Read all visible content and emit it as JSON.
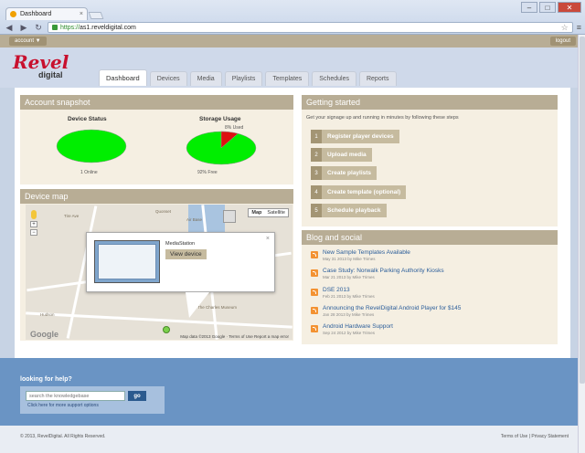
{
  "browser": {
    "tab_title": "Dashboard",
    "tab_close": "×",
    "url_scheme": "https://",
    "url_rest": "as1.reveldigital.com"
  },
  "account_bar": {
    "account_label": "account ▼",
    "logout_label": "logout"
  },
  "logo": {
    "main": "Revel",
    "sub": "digital"
  },
  "nav": {
    "tabs": [
      {
        "label": "Dashboard",
        "active": true
      },
      {
        "label": "Devices"
      },
      {
        "label": "Media"
      },
      {
        "label": "Playlists"
      },
      {
        "label": "Templates"
      },
      {
        "label": "Schedules"
      },
      {
        "label": "Reports"
      }
    ]
  },
  "snapshot": {
    "title": "Account snapshot",
    "device_status": {
      "title": "Device Status",
      "caption": "1 Online",
      "online_fraction": 1.0
    },
    "storage_usage": {
      "title": "Storage Usage",
      "used_label": "8% Used",
      "free_label": "92% Free",
      "used_fraction": 0.08
    }
  },
  "device_map": {
    "title": "Device map",
    "map_button": "Map",
    "satellite_button": "Satellite",
    "device_name": "MediaStation",
    "view_button": "View device",
    "close": "×",
    "attribution": "Map data ©2013 Google · Terms of Use  Report a map error",
    "google_logo": "Google",
    "labels": [
      "Tire Ave",
      "Quonset",
      "Air Base",
      "Hudson",
      "The Charles Museum",
      "Market St"
    ]
  },
  "getting_started": {
    "title": "Getting started",
    "intro": "Get your signage up and running in minutes by following these steps",
    "steps": [
      {
        "num": "1",
        "label": "Register player devices"
      },
      {
        "num": "2",
        "label": "Upload media"
      },
      {
        "num": "3",
        "label": "Create playlists"
      },
      {
        "num": "4",
        "label": "Create template (optional)"
      },
      {
        "num": "5",
        "label": "Schedule playback"
      }
    ]
  },
  "blog": {
    "title": "Blog and social",
    "items": [
      {
        "title": "New Sample Templates Available",
        "meta": "May 31 2013 by Mike Trimes"
      },
      {
        "title": "Case Study: Norwalk Parking Authority Kiosks",
        "meta": "Mar 21 2013 by Mike Trimes"
      },
      {
        "title": "DSE 2013",
        "meta": "Feb 21 2013 by Mike Trimes"
      },
      {
        "title": "Announcing the RevelDigital Android Player for $145",
        "meta": "Jan 28 2013 by Mike Trimes"
      },
      {
        "title": "Android Hardware Support",
        "meta": "Sep 24 2012 by Mike Trimes"
      }
    ]
  },
  "help": {
    "title": "looking for help?",
    "placeholder": "search the knowledgebase",
    "go": "go",
    "more": "Click here for more support options"
  },
  "footer": {
    "copyright": "© 2013, RevelDigital. All Rights Reserved.",
    "links": "Terms of Use | Privacy Statement"
  },
  "colors": {
    "accent": "#b8ad95",
    "online": "#00ee00",
    "used": "#dd1111",
    "help_band": "#6a94c4"
  }
}
